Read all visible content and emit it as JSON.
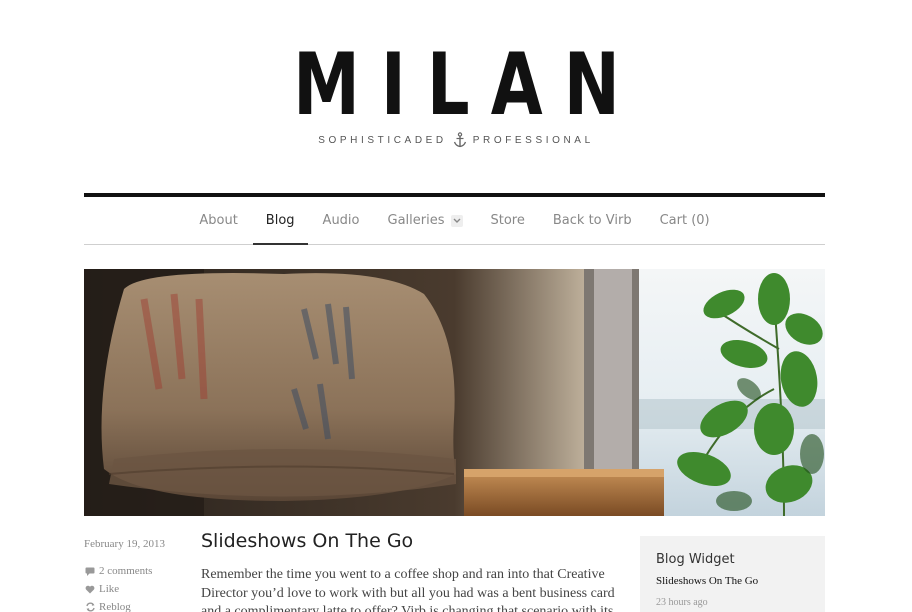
{
  "header": {
    "logo": "MILAN",
    "tagline_left": "SOPHISTICADED",
    "tagline_right": "PROFESSIONAL"
  },
  "nav": {
    "items": [
      {
        "label": "About"
      },
      {
        "label": "Blog"
      },
      {
        "label": "Audio"
      },
      {
        "label": "Galleries"
      },
      {
        "label": "Store"
      },
      {
        "label": "Back to Virb"
      },
      {
        "label": "Cart (0)"
      }
    ],
    "active": "Blog"
  },
  "post": {
    "date": "February 19, 2013",
    "comments": "2 comments",
    "like": "Like",
    "reblog": "Reblog",
    "title": "Slideshows On The Go",
    "excerpt": "Remember the time you went to a coffee shop and ran into that Creative Director you’d love to work with but all you had was a bent business card and a complimentary latte to offer? Virb is changing that scenario with its"
  },
  "widget": {
    "title": "Blog Widget",
    "link": "Slideshows On The Go",
    "time": "23 hours ago"
  },
  "icons": {
    "comment": "comment-icon",
    "like": "heart-icon",
    "reblog": "reblog-icon",
    "anchor": "anchor-icon",
    "dropdown": "chevron-down-icon"
  }
}
